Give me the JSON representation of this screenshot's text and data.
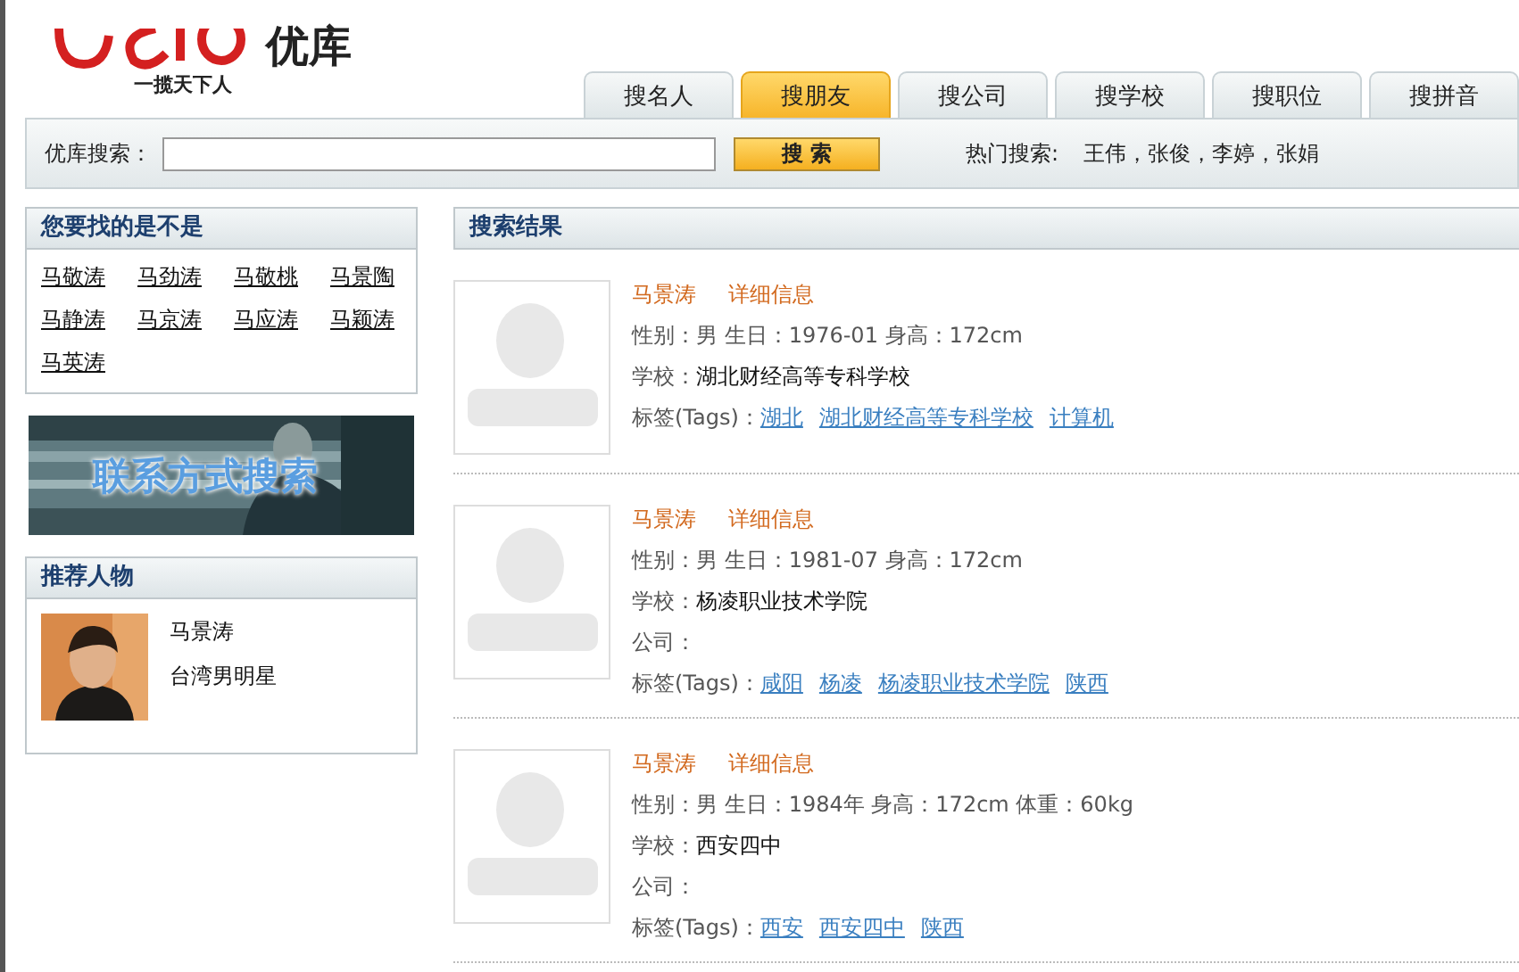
{
  "logo": {
    "name": "优库",
    "slogan": "一揽天下人"
  },
  "tabs": [
    {
      "label": "搜名人",
      "selected": false
    },
    {
      "label": "搜朋友",
      "selected": true
    },
    {
      "label": "搜公司",
      "selected": false
    },
    {
      "label": "搜学校",
      "selected": false
    },
    {
      "label": "搜职位",
      "selected": false
    },
    {
      "label": "搜拼音",
      "selected": false
    }
  ],
  "search": {
    "label": "优库搜索：",
    "button": "搜 索",
    "hot_label": "热门搜索:",
    "hot_terms": "王伟，张俊，李婷，张娟"
  },
  "suggestions": {
    "title": "您要找的是不是",
    "items": [
      "马敬涛",
      "马劲涛",
      "马敬桃",
      "马景陶",
      "马静涛",
      "马京涛",
      "马应涛",
      "马颖涛",
      "马英涛"
    ]
  },
  "banner": {
    "text": "联系方式搜索"
  },
  "featured": {
    "title": "推荐人物",
    "name": "马景涛",
    "description": "台湾男明星"
  },
  "results": {
    "title": "搜索结果",
    "items": [
      {
        "name": "马景涛",
        "detail_link": "详细信息",
        "info": "性别：男 生日：1976-01 身高：172cm",
        "fields": [
          {
            "label": "学校：",
            "value": "湖北财经高等专科学校"
          }
        ],
        "tags_label": "标签(Tags)：",
        "tags": [
          "湖北",
          "湖北财经高等专科学校",
          "计算机"
        ]
      },
      {
        "name": "马景涛",
        "detail_link": "详细信息",
        "info": "性别：男 生日：1981-07 身高：172cm",
        "fields": [
          {
            "label": "学校：",
            "value": "杨凌职业技术学院"
          },
          {
            "label": "公司："
          }
        ],
        "tags_label": "标签(Tags)：",
        "tags": [
          "咸阳",
          "杨凌",
          "杨凌职业技术学院",
          "陕西"
        ]
      },
      {
        "name": "马景涛",
        "detail_link": "详细信息",
        "info": "性别：男 生日：1984年 身高：172cm 体重：60kg",
        "fields": [
          {
            "label": "学校：",
            "value": "西安四中"
          },
          {
            "label": "公司："
          }
        ],
        "tags_label": "标签(Tags)：",
        "tags": [
          "西安",
          "西安四中",
          "陕西"
        ]
      }
    ]
  }
}
